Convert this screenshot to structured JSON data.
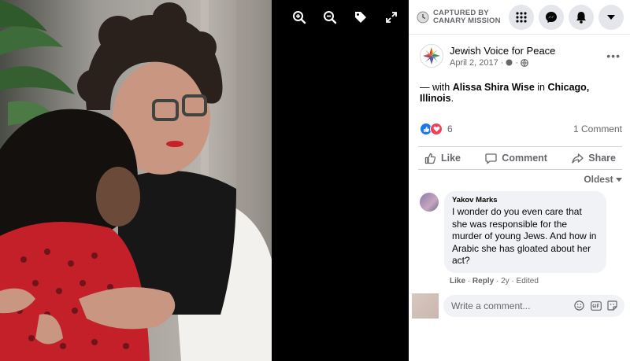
{
  "viewer": {
    "tools": [
      "zoom-in",
      "zoom-out",
      "tag",
      "fullscreen"
    ]
  },
  "topbar": {
    "capture_line1": "CAPTURED BY",
    "capture_line2": "CANARY MISSION",
    "icons": [
      "menu-grid-icon",
      "messenger-icon",
      "notifications-icon",
      "account-dropdown-icon"
    ]
  },
  "post": {
    "page_name": "Jewish Voice for Peace",
    "date": "April 2, 2017",
    "date_sep": "·",
    "text_prefix": "— with ",
    "tagged_person": "Alissa Shira Wise",
    "text_in": " in ",
    "location": "Chicago, Illinois",
    "text_suffix": ".",
    "reaction_count": "6",
    "comment_count": "1 Comment",
    "actions": {
      "like": "Like",
      "comment": "Comment",
      "share": "Share"
    },
    "sort_label": "Oldest"
  },
  "comment": {
    "author": "Yakov Marks",
    "text": "I wonder do you even care that she was responsible for the murder of young Jews. And how in Arabic she has gloated about her act?",
    "like": "Like",
    "reply": "Reply",
    "time": "2y",
    "edited": "Edited",
    "sep": "·"
  },
  "composer": {
    "placeholder": "Write a comment..."
  },
  "colors": {
    "accent": "#1877f2",
    "love": "#f33e58",
    "muted_text": "#65676b",
    "bubble_bg": "#f0f2f5"
  }
}
